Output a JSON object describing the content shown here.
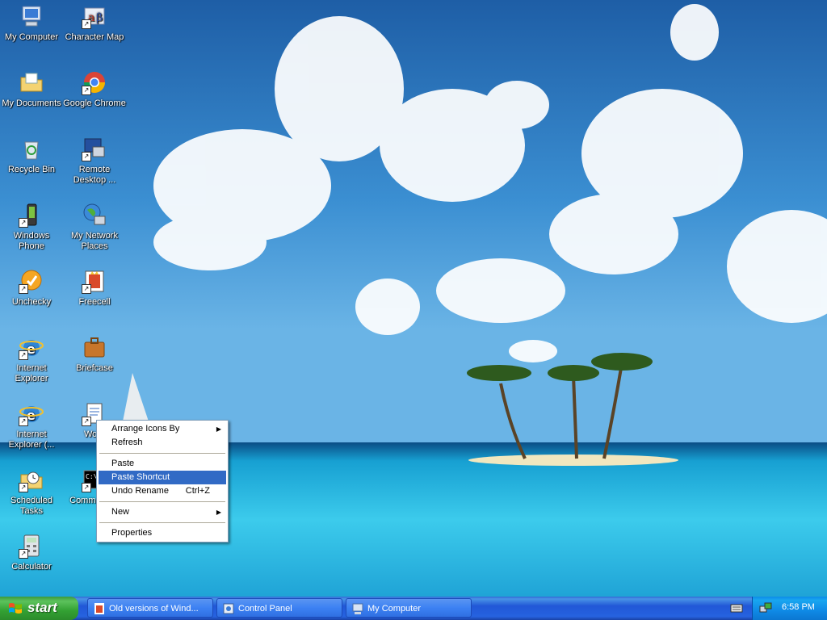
{
  "desktop": {
    "icons": [
      {
        "label": "My Computer"
      },
      {
        "label": "Character Map"
      },
      {
        "label": "My Documents"
      },
      {
        "label": "Google Chrome"
      },
      {
        "label": "Recycle Bin"
      },
      {
        "label": "Remote Desktop ..."
      },
      {
        "label": "Windows Phone"
      },
      {
        "label": "My Network Places"
      },
      {
        "label": "Unchecky"
      },
      {
        "label": "Freecell"
      },
      {
        "label": "Internet Explorer"
      },
      {
        "label": "Briefcase"
      },
      {
        "label": "Internet Explorer (..."
      },
      {
        "label": "Word"
      },
      {
        "label": "Scheduled Tasks"
      },
      {
        "label": "Comm Prom"
      },
      {
        "label": "Calculator"
      }
    ]
  },
  "context_menu": {
    "arrange_icons_by": "Arrange Icons By",
    "refresh": "Refresh",
    "paste": "Paste",
    "paste_shortcut": "Paste Shortcut",
    "undo_rename": "Undo Rename",
    "undo_rename_accel": "Ctrl+Z",
    "new": "New",
    "properties": "Properties"
  },
  "taskbar": {
    "start_label": "start",
    "tasks": [
      {
        "label": "Old versions of Wind..."
      },
      {
        "label": "Control Panel"
      },
      {
        "label": "My Computer"
      }
    ],
    "clock": "6:58 PM"
  },
  "colors": {
    "menu_highlight": "#316ac5",
    "taskbar": "#245edb",
    "start_button": "#3c9a3c",
    "tray": "#0f8ae6"
  }
}
